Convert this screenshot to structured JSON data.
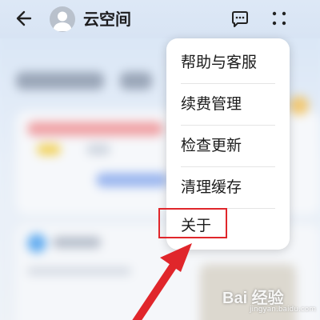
{
  "header": {
    "title": "云空间"
  },
  "menu": {
    "items": [
      {
        "label": "帮助与客服"
      },
      {
        "label": "续费管理"
      },
      {
        "label": "检查更新"
      },
      {
        "label": "清理缓存"
      },
      {
        "label": "关于"
      }
    ]
  },
  "annotation": {
    "highlight_color": "#e0262b",
    "arrow_color": "#e0262b"
  },
  "watermark": {
    "text": "Bai 经验",
    "sub": "jingyan.baidu.com"
  },
  "icons": {
    "back": "arrow-left-icon",
    "chat": "chat-bubble-icon",
    "more": "four-dots-icon"
  }
}
